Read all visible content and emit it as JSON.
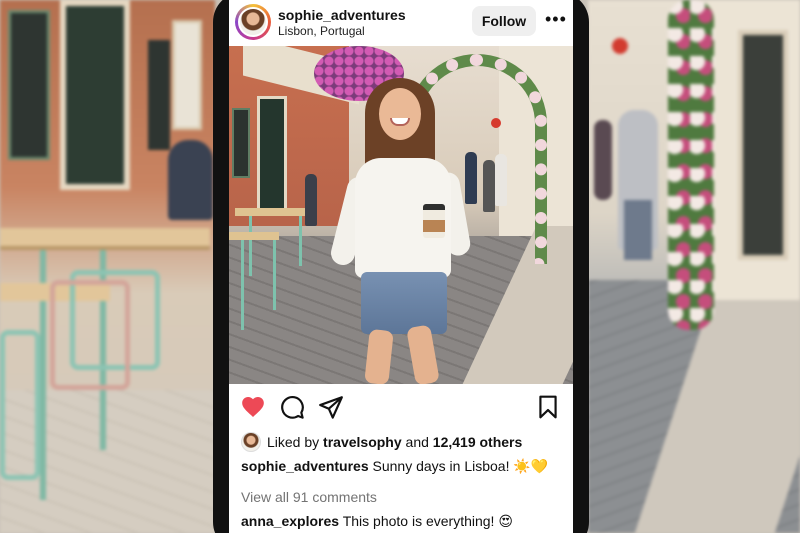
{
  "post": {
    "username": "sophie_adventures",
    "location": "Lisbon, Portugal",
    "follow_label": "Follow",
    "more_label": "•••"
  },
  "actions": {
    "like_color": "#ed4956",
    "liked": true
  },
  "likes": {
    "prefix": "Liked by",
    "liked_by": "travelsophy",
    "joiner": "and",
    "others": "12,419 others"
  },
  "caption": {
    "username": "sophie_adventures",
    "text": "Sunny days in Lisboa! ☀️💛"
  },
  "comments": {
    "view_all": "View all 91 comments",
    "first": {
      "username": "anna_explores",
      "text": "This photo is everything! 😍"
    }
  },
  "icons": [
    "heart-icon",
    "comment-icon",
    "share-icon",
    "bookmark-icon",
    "more-icon"
  ]
}
